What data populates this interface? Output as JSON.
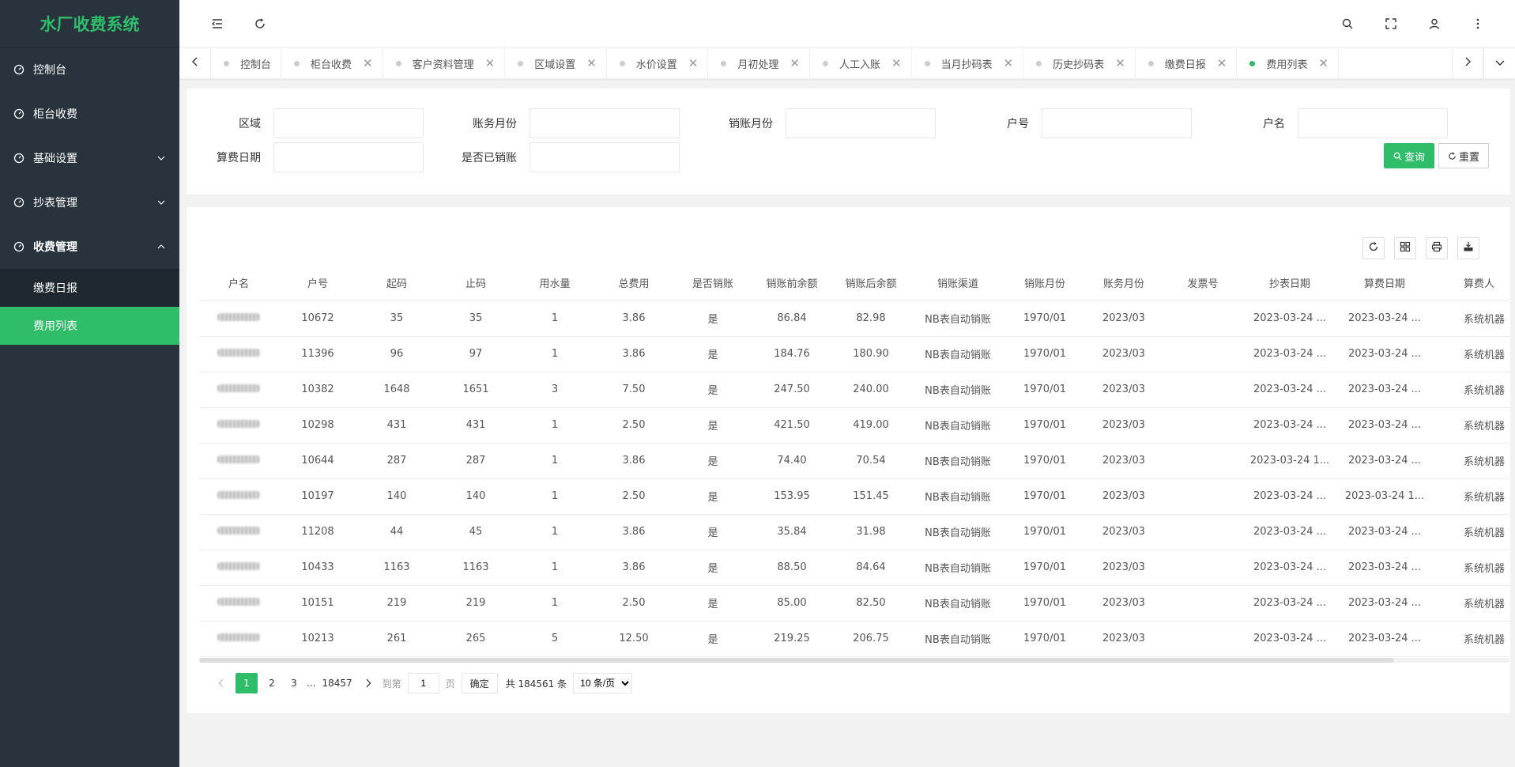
{
  "app": {
    "title": "水厂收费系统"
  },
  "sidebar": {
    "items": [
      {
        "label": "控制台"
      },
      {
        "label": "柜台收费"
      },
      {
        "label": "基础设置"
      },
      {
        "label": "抄表管理"
      },
      {
        "label": "收费管理"
      }
    ],
    "subitems": [
      {
        "label": "缴费日报"
      },
      {
        "label": "费用列表"
      }
    ]
  },
  "tabs": [
    {
      "label": "控制台"
    },
    {
      "label": "柜台收费"
    },
    {
      "label": "客户资料管理"
    },
    {
      "label": "区域设置"
    },
    {
      "label": "水价设置"
    },
    {
      "label": "月初处理"
    },
    {
      "label": "人工入账"
    },
    {
      "label": "当月抄码表"
    },
    {
      "label": "历史抄码表"
    },
    {
      "label": "缴费日报"
    },
    {
      "label": "费用列表"
    }
  ],
  "search": {
    "fields": [
      {
        "label": "区域"
      },
      {
        "label": "账务月份"
      },
      {
        "label": "销账月份"
      },
      {
        "label": "户号"
      },
      {
        "label": "户名"
      },
      {
        "label": "算费日期"
      },
      {
        "label": "是否已销账"
      }
    ],
    "query_label": "查询",
    "reset_label": "重置"
  },
  "table": {
    "columns": [
      "户名",
      "户号",
      "起码",
      "止码",
      "用水量",
      "总费用",
      "是否销账",
      "销账前余额",
      "销账后余额",
      "销账渠道",
      "销账月份",
      "账务月份",
      "发票号",
      "抄表日期",
      "算费日期",
      "算费人"
    ],
    "rows": [
      [
        "",
        "10672",
        "35",
        "35",
        "1",
        "3.86",
        "是",
        "86.84",
        "82.98",
        "NB表自动销账",
        "1970/01",
        "2023/03",
        "",
        "2023-03-24 ...",
        "2023-03-24 ...",
        "系统机器"
      ],
      [
        "",
        "11396",
        "96",
        "97",
        "1",
        "3.86",
        "是",
        "184.76",
        "180.90",
        "NB表自动销账",
        "1970/01",
        "2023/03",
        "",
        "2023-03-24 ...",
        "2023-03-24 ...",
        "系统机器"
      ],
      [
        "",
        "10382",
        "1648",
        "1651",
        "3",
        "7.50",
        "是",
        "247.50",
        "240.00",
        "NB表自动销账",
        "1970/01",
        "2023/03",
        "",
        "2023-03-24 ...",
        "2023-03-24 ...",
        "系统机器"
      ],
      [
        "",
        "10298",
        "431",
        "431",
        "1",
        "2.50",
        "是",
        "421.50",
        "419.00",
        "NB表自动销账",
        "1970/01",
        "2023/03",
        "",
        "2023-03-24 ...",
        "2023-03-24 ...",
        "系统机器"
      ],
      [
        "",
        "10644",
        "287",
        "287",
        "1",
        "3.86",
        "是",
        "74.40",
        "70.54",
        "NB表自动销账",
        "1970/01",
        "2023/03",
        "",
        "2023-03-24 1...",
        "2023-03-24 ...",
        "系统机器"
      ],
      [
        "",
        "10197",
        "140",
        "140",
        "1",
        "2.50",
        "是",
        "153.95",
        "151.45",
        "NB表自动销账",
        "1970/01",
        "2023/03",
        "",
        "2023-03-24 ...",
        "2023-03-24 1...",
        "系统机器"
      ],
      [
        "",
        "11208",
        "44",
        "45",
        "1",
        "3.86",
        "是",
        "35.84",
        "31.98",
        "NB表自动销账",
        "1970/01",
        "2023/03",
        "",
        "2023-03-24 ...",
        "2023-03-24 ...",
        "系统机器"
      ],
      [
        "",
        "10433",
        "1163",
        "1163",
        "1",
        "3.86",
        "是",
        "88.50",
        "84.64",
        "NB表自动销账",
        "1970/01",
        "2023/03",
        "",
        "2023-03-24 ...",
        "2023-03-24 ...",
        "系统机器"
      ],
      [
        "",
        "10151",
        "219",
        "219",
        "1",
        "2.50",
        "是",
        "85.00",
        "82.50",
        "NB表自动销账",
        "1970/01",
        "2023/03",
        "",
        "2023-03-24 ...",
        "2023-03-24 ...",
        "系统机器"
      ],
      [
        "",
        "10213",
        "261",
        "265",
        "5",
        "12.50",
        "是",
        "219.25",
        "206.75",
        "NB表自动销账",
        "1970/01",
        "2023/03",
        "",
        "2023-03-24 ...",
        "2023-03-24 ...",
        "系统机器"
      ]
    ]
  },
  "pagination": {
    "pages": [
      "1",
      "2",
      "3"
    ],
    "ellipsis": "...",
    "last_page": "18457",
    "goto_label": "到第",
    "page_value": "1",
    "page_unit": "页",
    "confirm_label": "确定",
    "total_label": "共 184561 条",
    "page_size_label": "10 条/页"
  },
  "colors": {
    "accent": "#2fbd6a",
    "sidebar_bg": "#28333e"
  }
}
